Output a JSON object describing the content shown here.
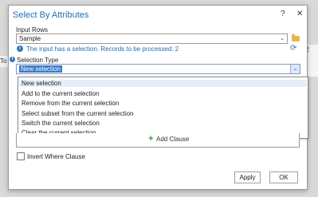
{
  "background": {
    "left_fragment": "To",
    "right_fragment": "2"
  },
  "dialog": {
    "title": "Select By Attributes",
    "help_label": "?",
    "close_label": "✕"
  },
  "input_rows": {
    "label": "Input Rows",
    "value": "Sample",
    "info": "The input has a selection. Records to be processed: 2"
  },
  "selection_type": {
    "label": "Selection Type",
    "value": "New selection",
    "options": [
      "New selection",
      "Add to the current selection",
      "Remove from the current selection",
      "Select subset from the current selection",
      "Switch the current selection",
      "Clear the current selection"
    ]
  },
  "add_clause_label": "Add Clause",
  "invert_where_label": "Invert Where Clause",
  "buttons": {
    "apply": "Apply",
    "ok": "OK"
  },
  "colors": {
    "accent": "#1f6fb5",
    "selected": "#3d79c4"
  }
}
